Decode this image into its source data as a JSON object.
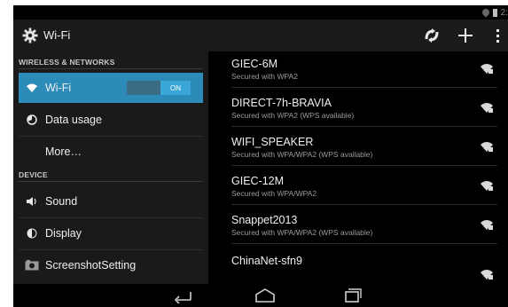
{
  "status_bar": {
    "clock": "2:"
  },
  "action_bar": {
    "title": "Wi-Fi"
  },
  "left_panel": {
    "sections": [
      {
        "header": "WIRELESS & NETWORKS"
      },
      {
        "header": "DEVICE"
      }
    ],
    "items": [
      {
        "label": "Wi-Fi",
        "icon": "wifi-icon",
        "toggle": "ON"
      },
      {
        "label": "Data usage",
        "icon": "data-usage-icon"
      },
      {
        "label": "More…"
      },
      {
        "label": "Sound",
        "icon": "speaker-icon"
      },
      {
        "label": "Display",
        "icon": "display-icon"
      },
      {
        "label": "ScreenshotSetting",
        "icon": "camera-icon"
      }
    ]
  },
  "networks": [
    {
      "ssid": "GIEC-6M",
      "security": "Secured with WPA2"
    },
    {
      "ssid": "DIRECT-7h-BRAVIA",
      "security": "Secured with WPA2 (WPS available)"
    },
    {
      "ssid": "WIFI_SPEAKER",
      "security": "Secured with WPA/WPA2 (WPS available)"
    },
    {
      "ssid": "GIEC-12M",
      "security": "Secured with WPA/WPA2"
    },
    {
      "ssid": "Snappet2013",
      "security": "Secured with WPA/WPA2 (WPS available)"
    },
    {
      "ssid": "ChinaNet-sfn9",
      "security": ""
    }
  ],
  "colors": {
    "accent": "#2d8bb9",
    "toggle_on": "#3aa6d8"
  }
}
